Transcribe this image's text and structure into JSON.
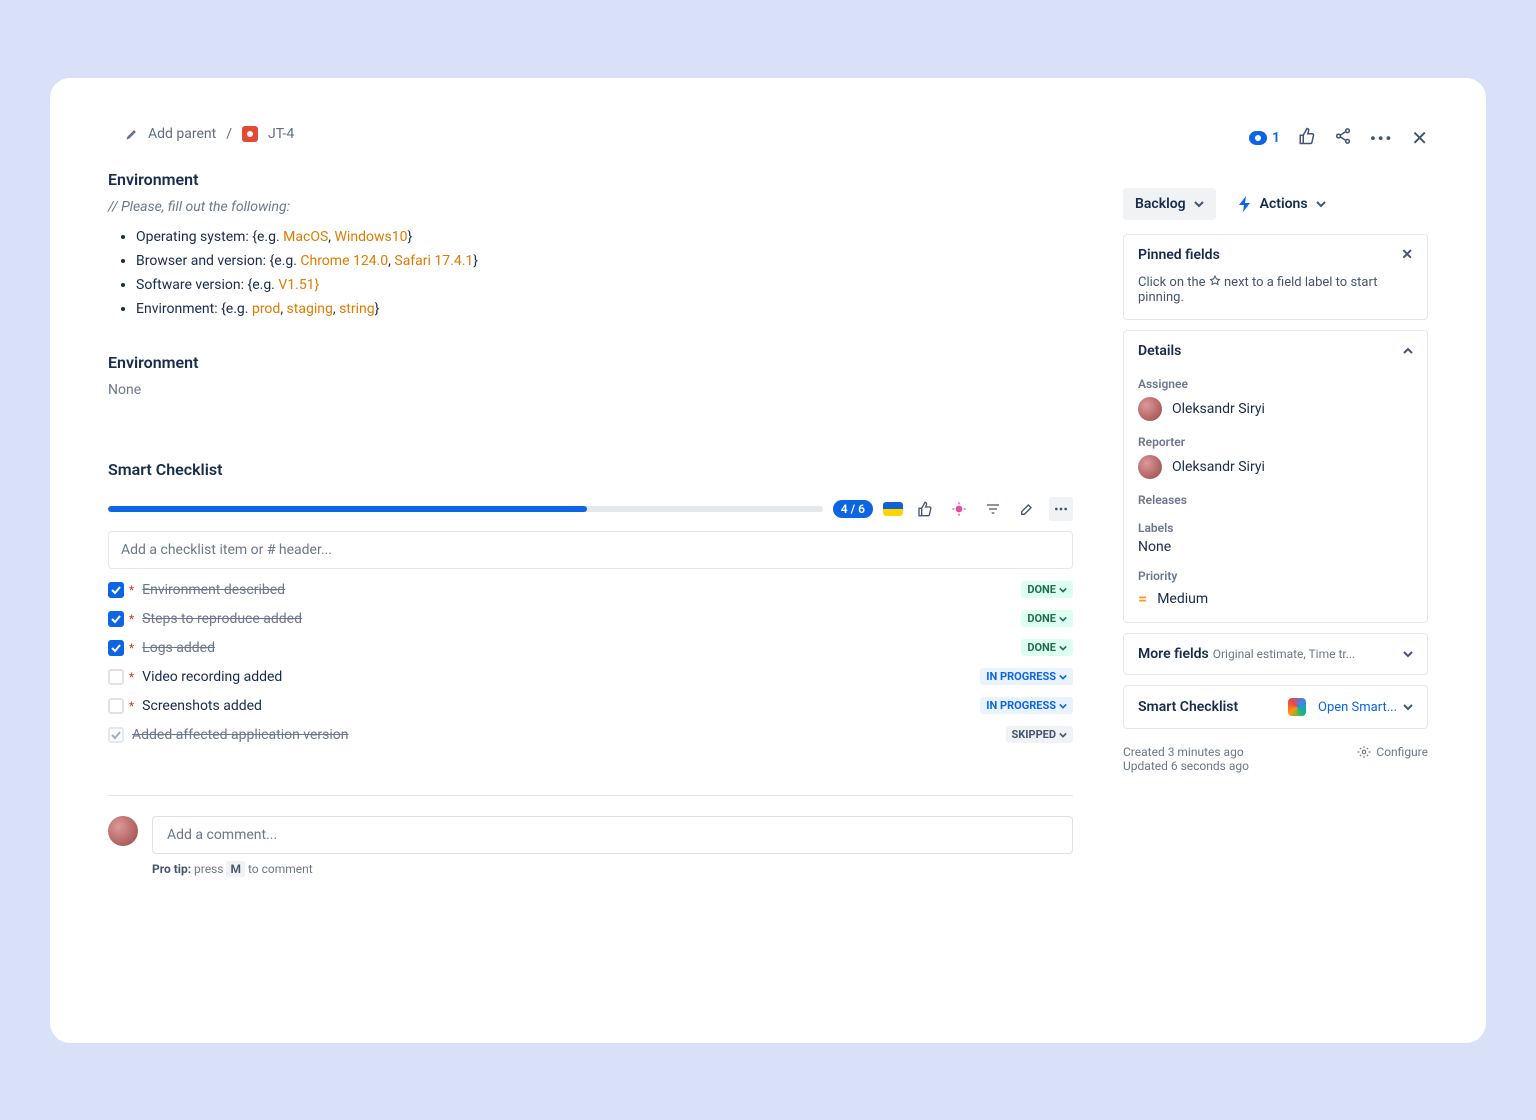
{
  "breadcrumb": {
    "addParent": "Add parent",
    "issueKey": "JT-4"
  },
  "environment": {
    "title": "Environment",
    "hint": "// Please, fill out the following:",
    "lines": [
      {
        "prefix": "Operating system: {e.g. ",
        "o1": "MacOS",
        "sep1": ", ",
        "o2": "Windows10",
        "suffix": "}"
      },
      {
        "prefix": "Browser and version: {e.g. ",
        "o1": "Chrome 124.0",
        "sep1": ", ",
        "o2": "Safari 17.4.1",
        "suffix": "}"
      },
      {
        "prefix": "Software version: {e.g. ",
        "o1": "V1.51}",
        "sep1": "",
        "o2": "",
        "suffix": ""
      },
      {
        "prefix": "Environment: {e.g. ",
        "o1": "prod",
        "sep1": ", ",
        "o2": "staging",
        "sep2": ", ",
        "o3": "string",
        "suffix": "}"
      }
    ],
    "second": {
      "title": "Environment",
      "value": "None"
    }
  },
  "checklist": {
    "title": "Smart Checklist",
    "count": "4 / 6",
    "progressPct": "67%",
    "placeholder": "Add a checklist item or # header...",
    "items": [
      {
        "label": "Environment described",
        "checked": true,
        "required": true,
        "status": "DONE",
        "statusClass": "done",
        "strike": true
      },
      {
        "label": "Steps to reproduce added",
        "checked": true,
        "required": true,
        "status": "DONE",
        "statusClass": "done",
        "strike": true
      },
      {
        "label": "Logs added",
        "checked": true,
        "required": true,
        "status": "DONE",
        "statusClass": "done",
        "strike": true
      },
      {
        "label": "Video recording added",
        "checked": false,
        "required": true,
        "status": "IN PROGRESS",
        "statusClass": "progress",
        "strike": false
      },
      {
        "label": "Screenshots added",
        "checked": false,
        "required": true,
        "status": "IN PROGRESS",
        "statusClass": "progress",
        "strike": false
      },
      {
        "label": "Added affected application version",
        "checked": false,
        "required": false,
        "skipped": true,
        "status": "SKIPPED",
        "statusClass": "skipped",
        "strike": true
      }
    ]
  },
  "comment": {
    "placeholder": "Add a comment...",
    "tipPrefix": "Pro tip:",
    "tipText1": " press ",
    "tipKey": "M",
    "tipText2": " to comment"
  },
  "side": {
    "watchers": "1",
    "status": "Backlog",
    "actions": "Actions",
    "pinned": {
      "title": "Pinned fields",
      "hint1": "Click on the ",
      "hint2": " next to a field label to start pinning."
    },
    "details": {
      "title": "Details",
      "assigneeLabel": "Assignee",
      "assignee": "Oleksandr Siryi",
      "reporterLabel": "Reporter",
      "reporter": "Oleksandr Siryi",
      "releasesLabel": "Releases",
      "labelsLabel": "Labels",
      "labelsValue": "None",
      "priorityLabel": "Priority",
      "priorityValue": "Medium"
    },
    "moreFields": {
      "label": "More fields",
      "sub": "Original estimate, Time tr..."
    },
    "smart": {
      "label": "Smart Checklist",
      "link": "Open Smart..."
    },
    "meta": {
      "created": "Created 3 minutes ago",
      "updated": "Updated 6 seconds ago",
      "configure": "Configure"
    }
  }
}
